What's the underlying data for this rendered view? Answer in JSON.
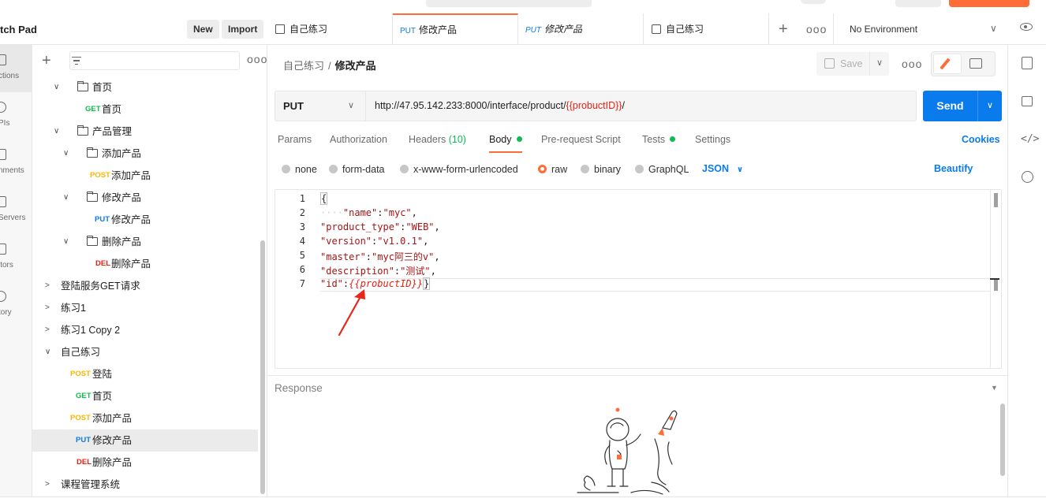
{
  "sidebar_header": {
    "title": "tch Pad",
    "new_label": "New",
    "import_label": "Import"
  },
  "left_nav": {
    "items": [
      {
        "label": "ctions",
        "icon": "collections-icon"
      },
      {
        "label": "PIs",
        "icon": "apis-icon"
      },
      {
        "label": "nments",
        "icon": "environments-icon"
      },
      {
        "label": "Servers",
        "icon": "mock-servers-icon"
      },
      {
        "label": "itors",
        "icon": "monitors-icon"
      },
      {
        "label": "tory",
        "icon": "history-icon"
      }
    ]
  },
  "sidebar": {
    "more": "ooo",
    "rows": [
      {
        "type": "folder",
        "label": "首页",
        "indent": 1,
        "open": true
      },
      {
        "type": "request",
        "method": "GET",
        "label": "首页",
        "indent": 2
      },
      {
        "type": "folder",
        "label": "产品管理",
        "indent": 1,
        "open": true
      },
      {
        "type": "folder",
        "label": "添加产品",
        "indent": 2,
        "open": true
      },
      {
        "type": "request",
        "method": "POST",
        "label": "添加产品",
        "indent": 3
      },
      {
        "type": "folder",
        "label": "修改产品",
        "indent": 2,
        "open": true
      },
      {
        "type": "request",
        "method": "PUT",
        "label": "修改产品",
        "indent": 3
      },
      {
        "type": "folder",
        "label": "删除产品",
        "indent": 2,
        "open": true
      },
      {
        "type": "request",
        "method": "DEL",
        "label": "删除产品",
        "indent": 3
      },
      {
        "type": "collection",
        "label": "登陆服务GET请求",
        "open": false
      },
      {
        "type": "collection",
        "label": "练习1",
        "open": false
      },
      {
        "type": "collection",
        "label": "练习1 Copy 2",
        "open": false
      },
      {
        "type": "collection",
        "label": "自己练习",
        "open": true
      },
      {
        "type": "request",
        "method": "POST",
        "label": "登陆",
        "indent": 1
      },
      {
        "type": "request",
        "method": "GET",
        "label": "首页",
        "indent": 1
      },
      {
        "type": "request",
        "method": "POST",
        "label": "添加产品",
        "indent": 1
      },
      {
        "type": "request",
        "method": "PUT",
        "label": "修改产品",
        "indent": 1,
        "selected": true
      },
      {
        "type": "request",
        "method": "DEL",
        "label": "删除产品",
        "indent": 1
      },
      {
        "type": "collection",
        "label": "课程管理系统",
        "open": false
      }
    ]
  },
  "tabs": [
    {
      "label": "自己练习",
      "icon": "collection-icon"
    },
    {
      "label": "修改产品",
      "method": "PUT",
      "active": true
    },
    {
      "label": "修改产品",
      "method": "PUT",
      "italic": true
    },
    {
      "label": "自己练习",
      "icon": "runner-icon"
    }
  ],
  "tabbar": {
    "more": "ooo",
    "environment": "No Environment"
  },
  "request": {
    "breadcrumb_parent": "自己练习",
    "breadcrumb_sep": "/",
    "breadcrumb_current": "修改产品",
    "save_label": "Save",
    "more": "ooo",
    "method": "PUT",
    "url_prefix": "http://47.95.142.233:8000/interface/product/",
    "url_var": "{{probuctID}}",
    "url_suffix": "/",
    "send_label": "Send"
  },
  "req_tabs": {
    "params": "Params",
    "authorization": "Authorization",
    "headers": "Headers",
    "headers_count": "(10)",
    "body": "Body",
    "prerequest": "Pre-request Script",
    "tests": "Tests",
    "settings": "Settings",
    "cookies": "Cookies"
  },
  "body_types": {
    "none": "none",
    "form_data": "form-data",
    "urlencoded": "x-www-form-urlencoded",
    "raw": "raw",
    "binary": "binary",
    "graphql": "GraphQL",
    "format": "JSON",
    "beautify": "Beautify"
  },
  "editor": {
    "line_numbers": [
      "1",
      "2",
      "3",
      "4",
      "5",
      "6",
      "7"
    ],
    "lines": {
      "l1": "{",
      "l2_ws": "····",
      "l2_key": "\"name\"",
      "l2_val": "\"myc\"",
      "l3_key": "\"product_type\"",
      "l3_val": "\"WEB\"",
      "l4_key": "\"version\"",
      "l4_val": "\"v1.0.1\"",
      "l5_key": "\"master\"",
      "l5_val": "\"myc阿三的v\"",
      "l6_key": "\"description\"",
      "l6_val": "\"测试\"",
      "l7_key": "\"id\"",
      "l7_val": "{{probuctID}}",
      "l7_end": "}"
    }
  },
  "response": {
    "label": "Response"
  },
  "colors": {
    "accent": "#ff6c37",
    "primary": "#097bed",
    "get": "#0cbb52",
    "post": "#ffb400",
    "put": "#097bed",
    "del": "#eb2013",
    "arrow": "#e8271b"
  }
}
